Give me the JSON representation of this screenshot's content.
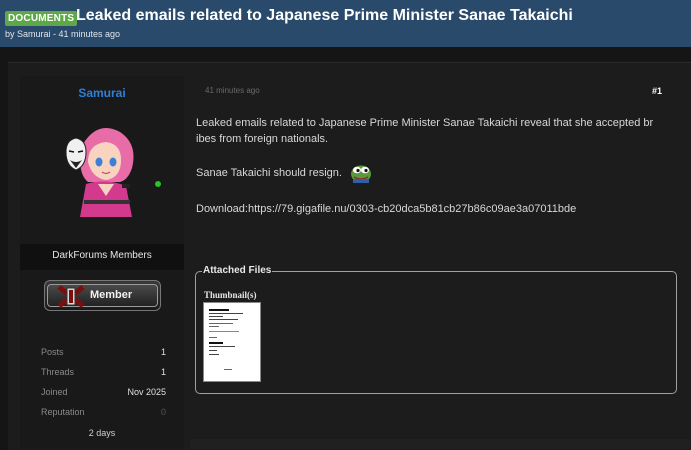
{
  "thread": {
    "tag": "DOCUMENTS",
    "title": "Leaked emails related to Japanese Prime Minister Sanae Takaichi",
    "byline": "by Samurai - 41 minutes ago"
  },
  "author": {
    "username": "Samurai",
    "group": "DarkForums Members",
    "rank_badge": "Member",
    "online": true,
    "stats": [
      {
        "label": "Posts",
        "value": "1"
      },
      {
        "label": "Threads",
        "value": "1"
      },
      {
        "label": "Joined",
        "value": "Nov 2025"
      },
      {
        "label": "Reputation",
        "value": "0"
      }
    ],
    "last_seen": "2 days"
  },
  "post": {
    "date": "41 minutes ago",
    "number": "#1",
    "line1": "Leaked emails related to Japanese Prime Minister Sanae Takaichi reveal that she accepted br",
    "line2": "ibes from foreign nationals.",
    "line3": "Sanae Takaichi should resign.",
    "line4": "Download:https://79.gigafile.nu/0303-cb20dca5b81cb27b86c09ae3a07011bde",
    "emoji": "pepe-icon"
  },
  "attachments": {
    "legend": "Attached Files",
    "thumbnails_label": "Thumbnail(s)"
  },
  "colors": {
    "header": "#2a4a6b",
    "tag": "#5fa84a",
    "username": "#2f7fd6",
    "online": "#27c427"
  }
}
